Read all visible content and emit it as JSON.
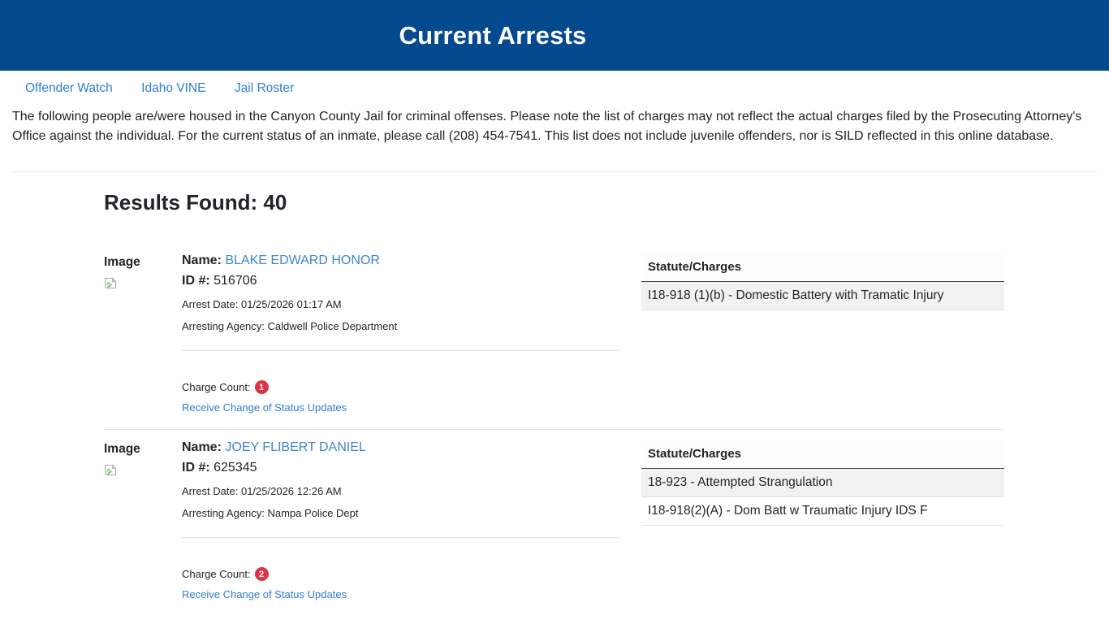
{
  "header": {
    "title": "Current Arrests"
  },
  "nav": {
    "items": [
      {
        "label": "Offender Watch"
      },
      {
        "label": "Idaho VINE"
      },
      {
        "label": "Jail Roster"
      }
    ]
  },
  "intro_text": "The following people are/were housed in the Canyon County Jail for criminal offenses. Please note the list of charges may not reflect the actual charges filed by the Prosecuting Attorney's Office against the individual. For the current status of an inmate, please call (208) 454-7541. This list does not include juvenile offenders, nor is SILD reflected in this online database.",
  "results": {
    "heading": "Results Found: 40",
    "count": 40
  },
  "labels": {
    "image": "Image",
    "name": "Name:",
    "id": "ID #:",
    "charge_count": "Charge Count:",
    "status_link": "Receive Change of Status Updates",
    "charges_header": "Statute/Charges"
  },
  "records": [
    {
      "name": "BLAKE EDWARD HONOR",
      "id": "516706",
      "arrest_date_line": "Arrest Date: 01/25/2026 01:17 AM",
      "agency_line": "Arresting Agency: Caldwell Police Department",
      "charge_count": "1",
      "charges": [
        "I18-918 (1)(b) - Domestic Battery with Tramatic Injury"
      ]
    },
    {
      "name": "JOEY FLIBERT DANIEL",
      "id": "625345",
      "arrest_date_line": "Arrest Date: 01/25/2026 12:26 AM",
      "agency_line": "Arresting Agency: Nampa Police Dept",
      "charge_count": "2",
      "charges": [
        "18-923 - Attempted Strangulation",
        "I18-918(2)(A) - Dom Batt w Traumatic Injury IDS F"
      ]
    }
  ],
  "icons": {
    "broken_image": "broken-image-icon"
  },
  "colors": {
    "header_background": "#05498f",
    "link_blue": "#2e7fd1",
    "name_link_blue": "#3e87cc",
    "badge_red": "#dc3545",
    "stripe_gray": "#f2f2f2"
  }
}
